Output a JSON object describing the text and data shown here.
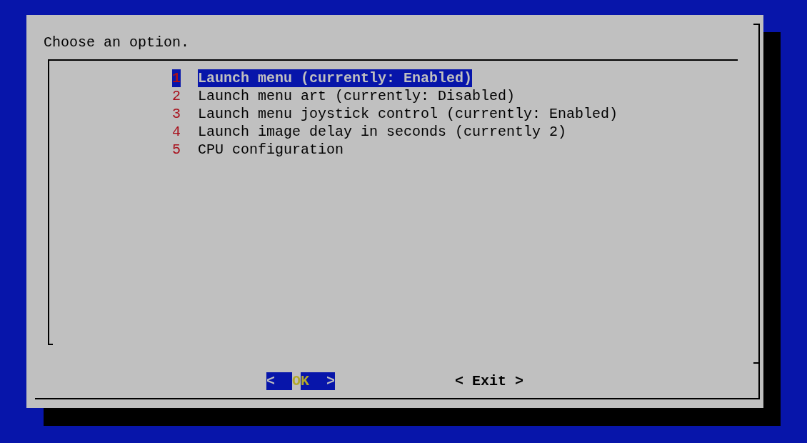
{
  "prompt": "Choose an option.",
  "menu": {
    "items": [
      {
        "tag": "1",
        "label": "Launch menu (currently: Enabled)",
        "selected": true
      },
      {
        "tag": "2",
        "label": "Launch menu art (currently: Disabled)",
        "selected": false
      },
      {
        "tag": "3",
        "label": "Launch menu joystick control (currently: Enabled)",
        "selected": false
      },
      {
        "tag": "4",
        "label": "Launch image delay in seconds (currently 2)",
        "selected": false
      },
      {
        "tag": "5",
        "label": "CPU configuration",
        "selected": false
      }
    ]
  },
  "buttons": [
    {
      "left": "<",
      "label": "OK",
      "right": ">",
      "selected": true
    },
    {
      "left": "<",
      "label": "Exit",
      "right": ">",
      "selected": false
    }
  ]
}
